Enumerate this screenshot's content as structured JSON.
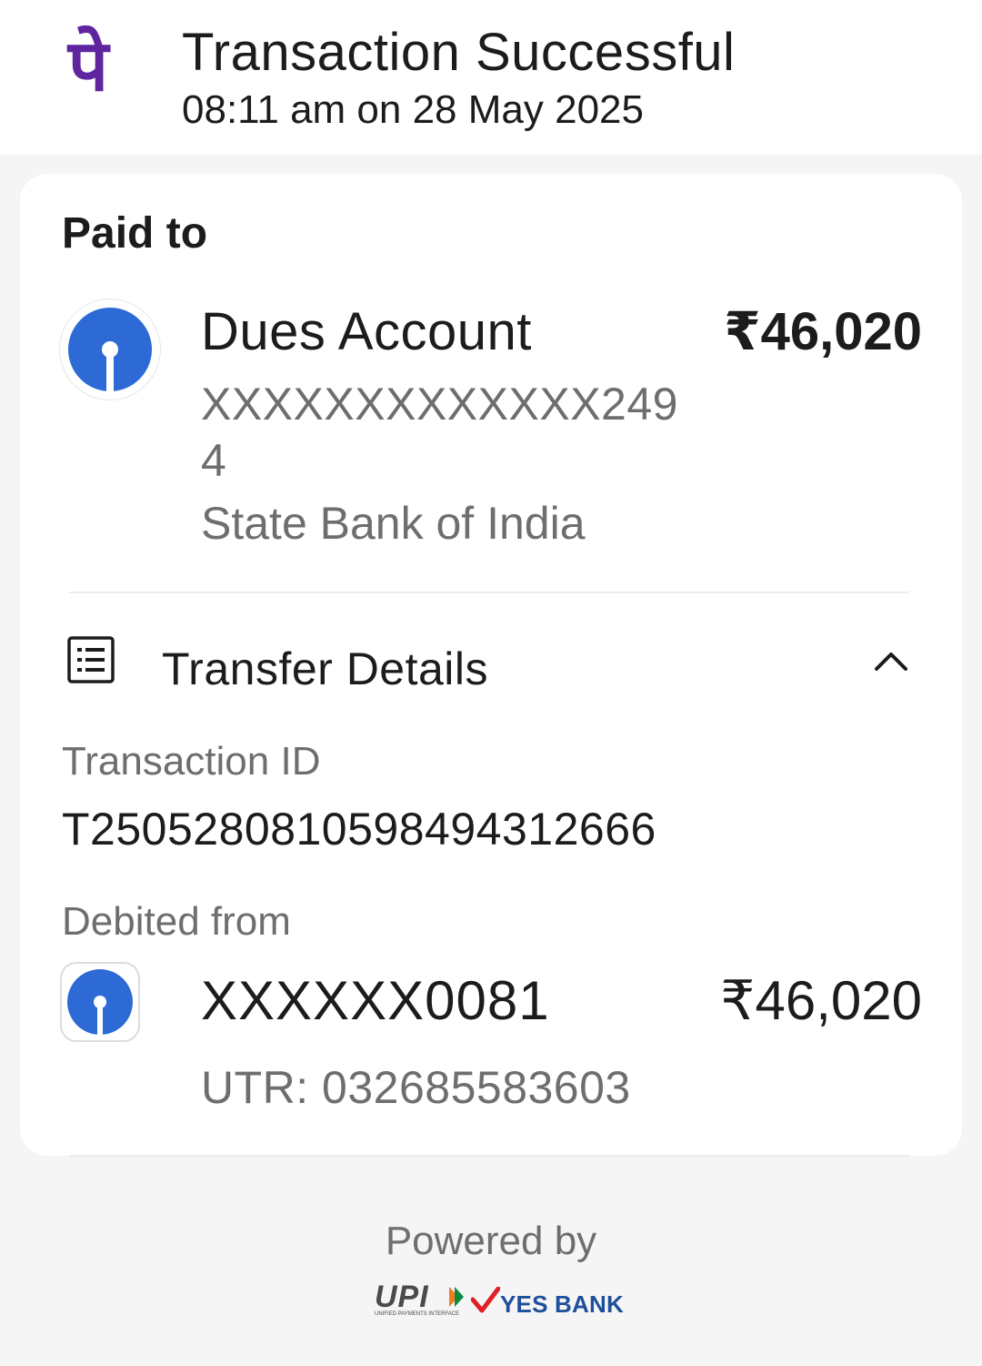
{
  "header": {
    "title": "Transaction Successful",
    "subtitle": "08:11 am on 28 May 2025",
    "logo_glyph": "पे"
  },
  "paid_to": {
    "label": "Paid to",
    "name": "Dues Account",
    "amount": "₹46,020",
    "account": "XXXXXXXXXXXXX2494",
    "bank": "State Bank of India",
    "icon": "sbi-logo-icon"
  },
  "transfer_details": {
    "title": "Transfer Details",
    "icon": "receipt-list-icon",
    "toggle_icon": "chevron-up-icon",
    "transaction_id_label": "Transaction ID",
    "transaction_id": "T2505280810598494312666",
    "debited_from_label": "Debited from",
    "debit_account": "XXXXXX0081",
    "debit_amount": "₹46,020",
    "utr": "UTR: 032685583603"
  },
  "footer": {
    "powered_by": "Powered by",
    "upi_text": "UPI",
    "upi_subtext": "UNIFIED PAYMENTS INTERFACE",
    "bank_name": "YES BANK"
  },
  "colors": {
    "brand_purple": "#5f259f",
    "sbi_blue": "#2d6ad6",
    "yes_bank_blue": "#1d4f9c",
    "yes_bank_red": "#e02028"
  }
}
